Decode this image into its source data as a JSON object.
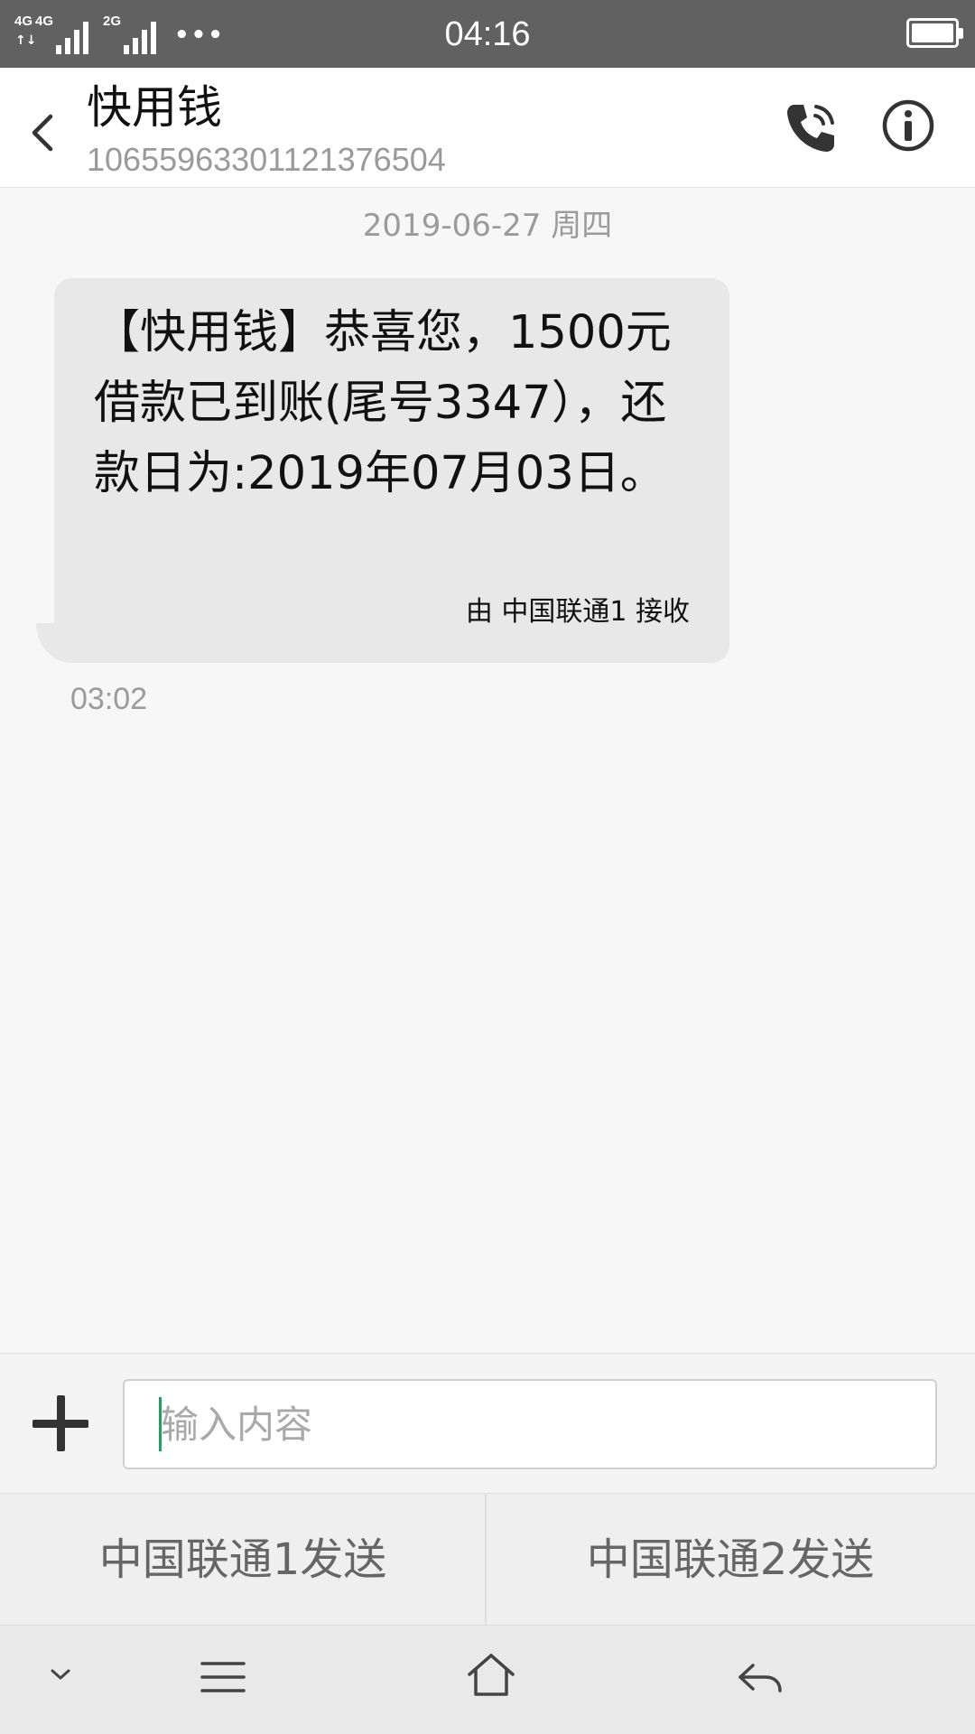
{
  "status_bar": {
    "network_1": "4G",
    "network_2": "4G",
    "network_3": "2G",
    "more": "•••",
    "time": "04:16",
    "battery_level": 1.0
  },
  "header": {
    "contact_name": "快用钱",
    "contact_number": "10655963301121376504",
    "back_icon": "chevron-left-icon",
    "call_icon": "phone-icon",
    "info_icon": "info-icon"
  },
  "conversation": {
    "date": "2019-06-27 周四",
    "messages": [
      {
        "text": "【快用钱】恭喜您，1500元借款已到账(尾号3347），还款日为:2019年07月03日。",
        "receiver": "由 中国联通1 接收",
        "time": "03:02"
      }
    ]
  },
  "composer": {
    "placeholder": "输入内容",
    "value": "",
    "attach_icon": "plus-icon"
  },
  "send": {
    "sim1_label": "中国联通1发送",
    "sim2_label": "中国联通2发送"
  },
  "nav": {
    "icons": [
      "chevron-down-icon",
      "menu-icon",
      "home-icon",
      "back-arrow-icon"
    ]
  },
  "colors": {
    "status_bar": "#616161",
    "bubble": "#e8e8e8",
    "caret": "#1aa260"
  }
}
